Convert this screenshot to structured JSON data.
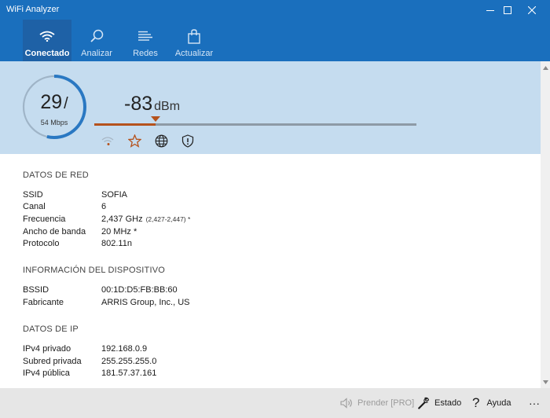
{
  "window": {
    "title": "WiFi Analyzer"
  },
  "toolbar": {
    "tabs": [
      {
        "label": "Conectado",
        "icon": "wifi-icon"
      },
      {
        "label": "Analizar",
        "icon": "magnifier-icon"
      },
      {
        "label": "Redes",
        "icon": "list-icon"
      },
      {
        "label": "Actualizar",
        "icon": "shopping-bag-icon"
      }
    ]
  },
  "status": {
    "speed": "29",
    "speed_sep": "/",
    "max_speed": "54 Mbps",
    "signal_value": "-83",
    "signal_unit": "dBm",
    "signal_level": 0.19
  },
  "network": {
    "heading": "DATOS DE RED",
    "rows": [
      {
        "key": "SSID",
        "value": "SOFIA",
        "aux": ""
      },
      {
        "key": "Canal",
        "value": "6",
        "aux": ""
      },
      {
        "key": "Frecuencia",
        "value": "2,437 GHz",
        "aux": "(2,427-2,447) *"
      },
      {
        "key": "Ancho de banda",
        "value": "20 MHz *",
        "aux": ""
      },
      {
        "key": "Protocolo",
        "value": "802.11n",
        "aux": ""
      }
    ]
  },
  "device": {
    "heading": "INFORMACIÓN DEL DISPOSITIVO",
    "rows": [
      {
        "key": "BSSID",
        "value": "00:1D:D5:FB:BB:60"
      },
      {
        "key": "Fabricante",
        "value": "ARRIS Group, Inc., US"
      }
    ]
  },
  "ip": {
    "heading": "DATOS DE IP",
    "rows": [
      {
        "key": "IPv4 privado",
        "value": "192.168.0.9"
      },
      {
        "key": "Subred privada",
        "value": "255.255.255.0"
      },
      {
        "key": "IPv4 pública",
        "value": "181.57.37.161"
      }
    ]
  },
  "bottom": {
    "speak_label": "Prender [PRO]",
    "status_label": "Estado",
    "help_label": "Ayuda",
    "more_label": "···"
  },
  "colors": {
    "accent": "#1a6fbd",
    "band": "#c5dcef",
    "signal": "#b5521c"
  }
}
